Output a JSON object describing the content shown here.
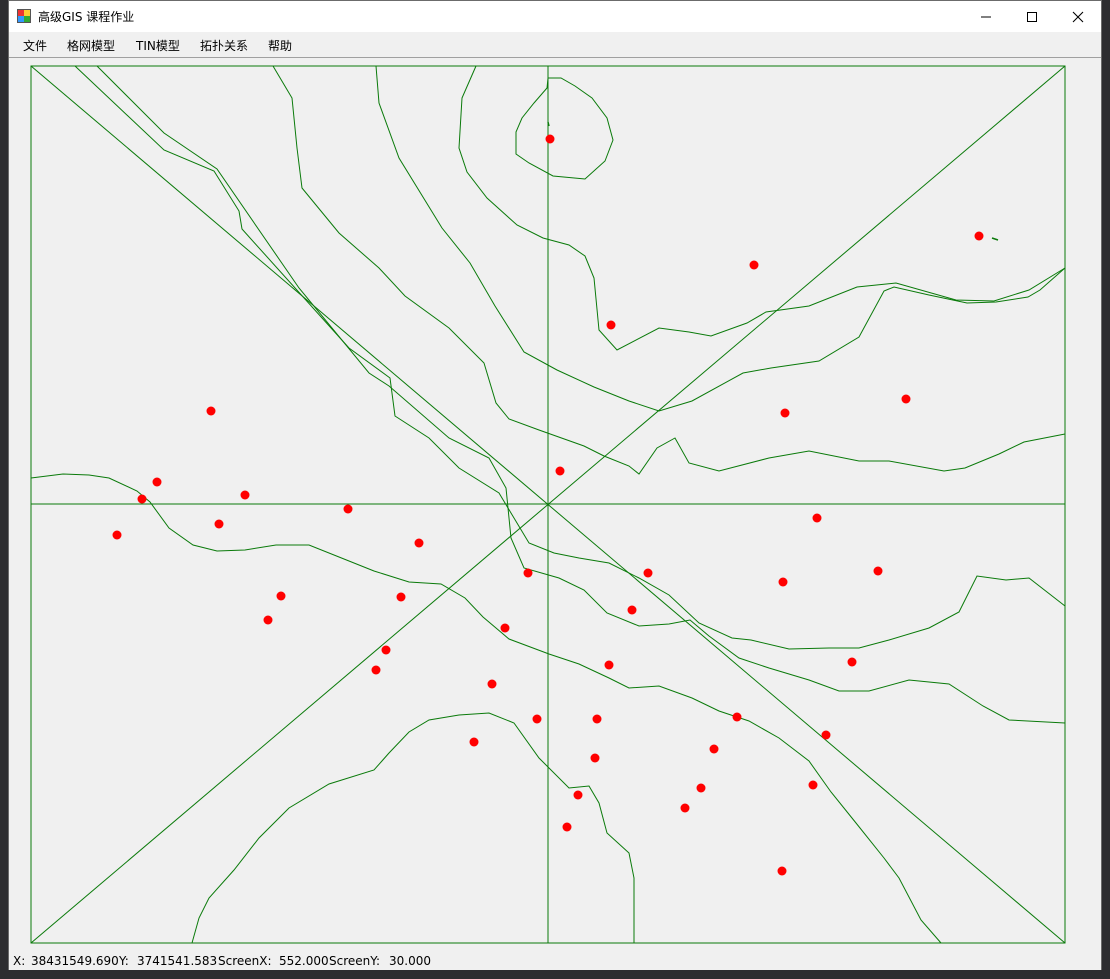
{
  "window": {
    "title": "高级GIS 课程作业"
  },
  "menu": {
    "items": [
      "文件",
      "格网模型",
      "TIN模型",
      "拓扑关系",
      "帮助"
    ]
  },
  "status": {
    "x_label": "X:",
    "x_value": "38431549.690",
    "y_label": "Y:",
    "y_value": "3741541.583",
    "sx_label": "ScreenX:",
    "sx_value": "552.000",
    "sy_label": "ScreenY:",
    "sy_value": "30.000"
  },
  "colors": {
    "line": "#0a7a0a",
    "point": "#ff0000",
    "frame": "#0a7a0a",
    "background": "#f0f0f0"
  }
}
